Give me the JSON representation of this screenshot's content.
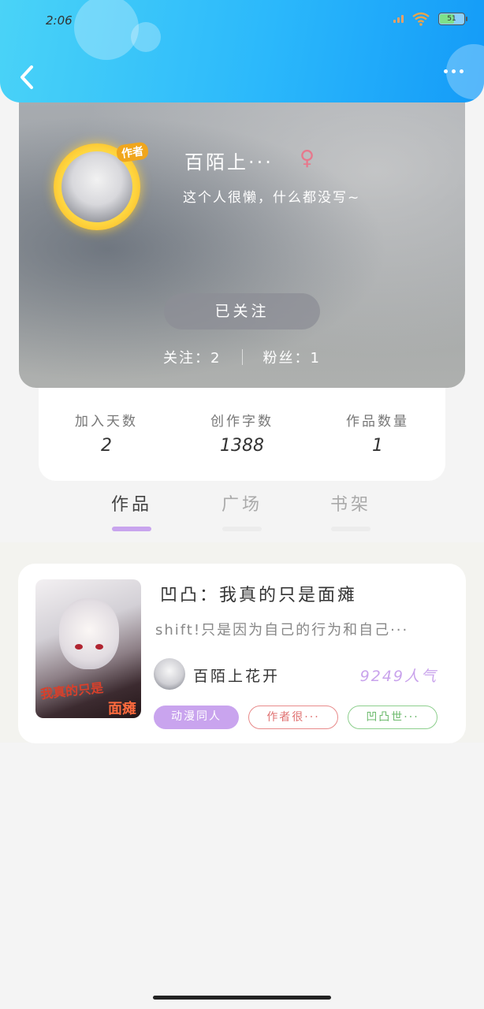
{
  "status": {
    "time": "2:06",
    "battery": "51"
  },
  "profile": {
    "username": "百陌上···",
    "gender_symbol": "♀",
    "badge": "作者",
    "bio": "这个人很懒，什么都没写~",
    "follow_button": "已关注",
    "following_label": "关注：",
    "following_count": "2",
    "fans_label": "粉丝：",
    "fans_count": "1"
  },
  "stats": [
    {
      "label": "加入天数",
      "value": "2"
    },
    {
      "label": "创作字数",
      "value": "1388"
    },
    {
      "label": "作品数量",
      "value": "1"
    }
  ],
  "tabs": [
    {
      "label": "作品",
      "active": true
    },
    {
      "label": "广场",
      "active": false
    },
    {
      "label": "书架",
      "active": false
    }
  ],
  "work": {
    "title": "凹凸：我真的只是面瘫",
    "description": "shift!只是因为自己的行为和自己···",
    "author": "百陌上花开",
    "popularity": "9249人气",
    "cover_text_1": "我真的只是",
    "cover_text_2": "面瘫",
    "tags": [
      "动漫同人",
      "作者很···",
      "凹凸世···"
    ]
  },
  "colors": {
    "header_blue": "#2bb8fb",
    "accent_purple": "#c8a4ee",
    "tag_red": "#e07272",
    "tag_green": "#6bb96b"
  }
}
